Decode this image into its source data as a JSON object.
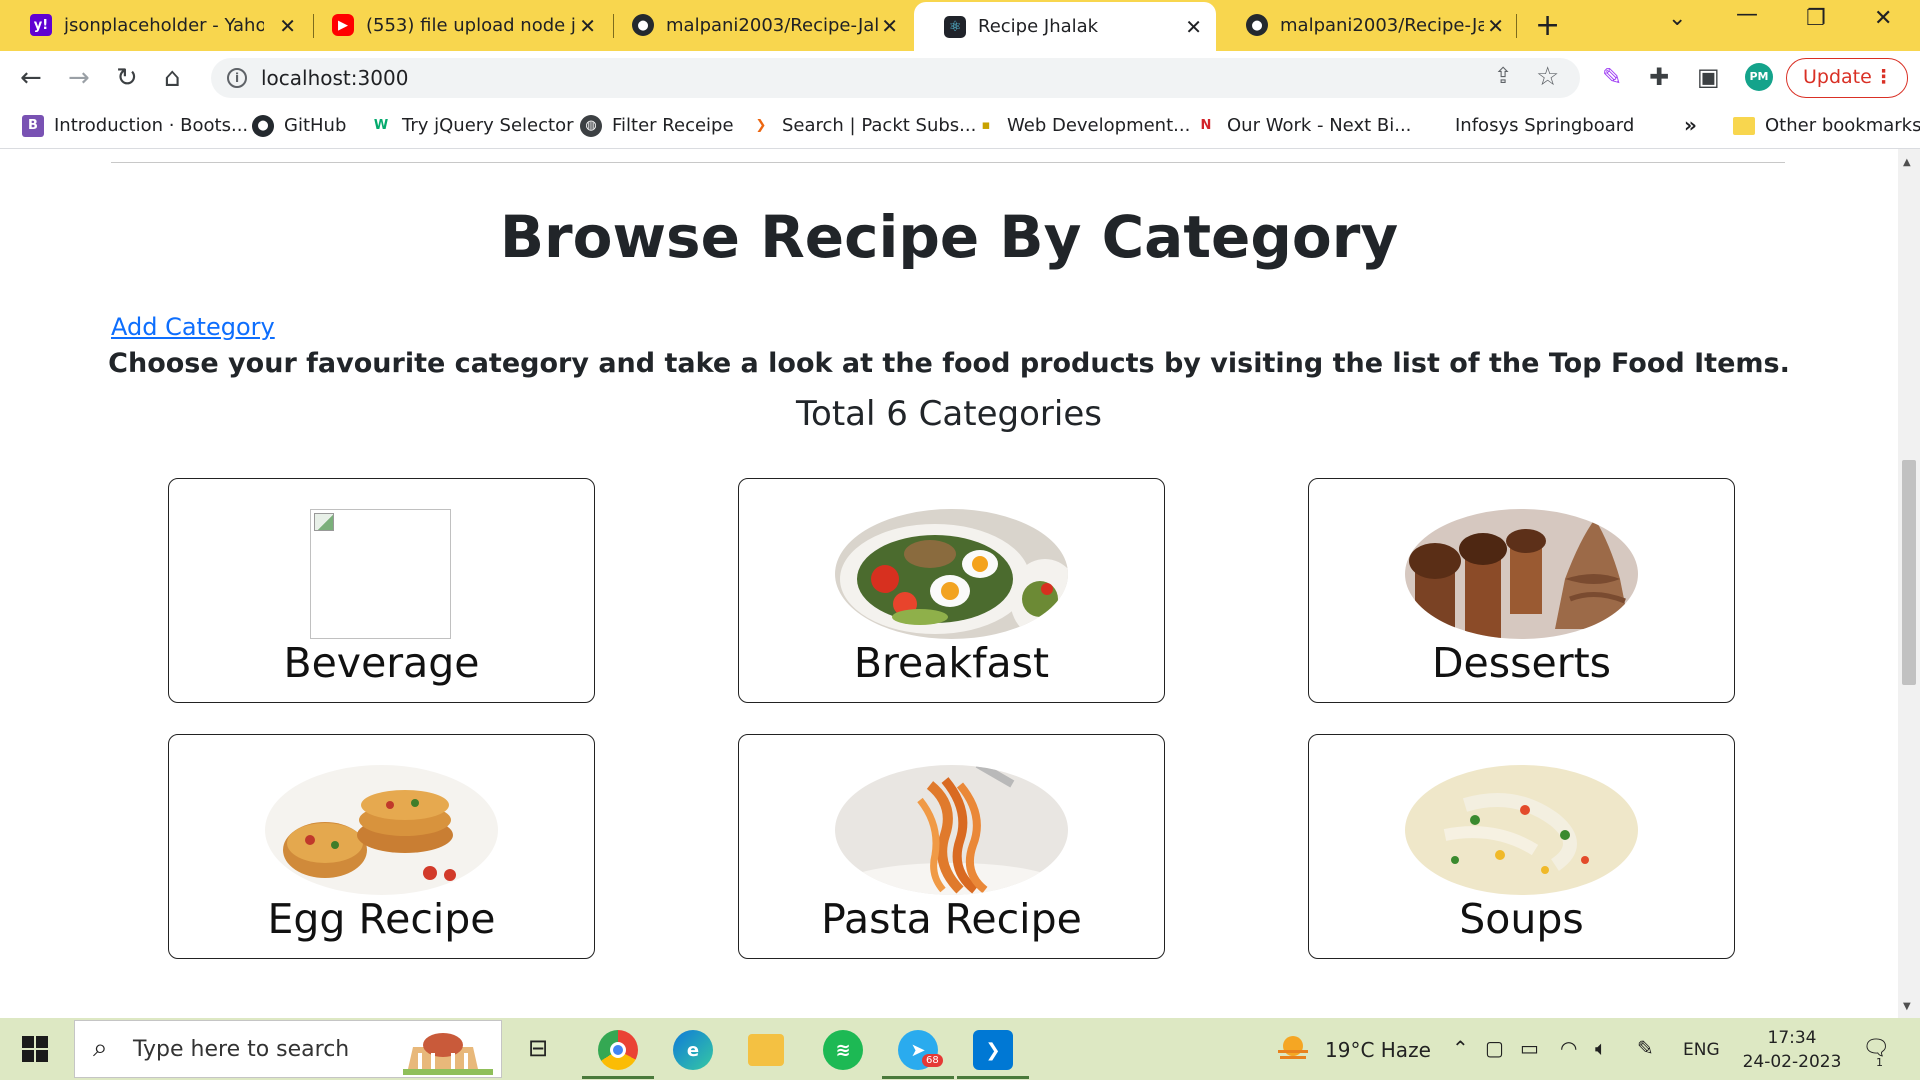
{
  "browser": {
    "tabs": [
      {
        "label": "jsonplaceholder - Yahoo Ir",
        "favicon": "yahoo-icon",
        "active": false
      },
      {
        "label": "(553) file upload node js n",
        "favicon": "youtube-icon",
        "active": false
      },
      {
        "label": "malpani2003/Recipe-Jalak",
        "favicon": "github-icon",
        "active": false
      },
      {
        "label": "Recipe Jhalak",
        "favicon": "react-icon",
        "active": true
      },
      {
        "label": "malpani2003/Recipe-Jalak",
        "favicon": "github-icon",
        "active": false
      }
    ],
    "url": "localhost:3000",
    "update_label": "Update",
    "profile_initials": "PM",
    "bookmarks": [
      {
        "label": "Introduction · Boots...",
        "icon": "bootstrap-icon"
      },
      {
        "label": "GitHub",
        "icon": "github-icon"
      },
      {
        "label": "Try jQuery Selector",
        "icon": "w3schools-icon"
      },
      {
        "label": "Filter Receipe",
        "icon": "globe-icon"
      },
      {
        "label": "Search | Packt Subs...",
        "icon": "packt-icon"
      },
      {
        "label": "Web Development...",
        "icon": "bookmark-icon"
      },
      {
        "label": "Our Work - Next Bi...",
        "icon": "nct-icon"
      },
      {
        "label": "Infosys Springboard",
        "icon": ""
      }
    ],
    "bookmarks_more": "»",
    "other_bookmarks": "Other bookmarks"
  },
  "page": {
    "title": "Browse Recipe By Category",
    "add_category_link": "Add Category",
    "intro": "Choose your favourite category and take a look at the food products by visiting the list of the Top Food Items.",
    "total": "Total 6 Categories",
    "categories": [
      {
        "name": "Beverage",
        "image": "broken"
      },
      {
        "name": "Breakfast",
        "image": "breakfast-bowl"
      },
      {
        "name": "Desserts",
        "image": "chocolate-cupcakes"
      },
      {
        "name": "Egg Recipe",
        "image": "egg-muffins"
      },
      {
        "name": "Pasta Recipe",
        "image": "spaghetti-fork"
      },
      {
        "name": "Soups",
        "image": "creamy-soup"
      }
    ]
  },
  "taskbar": {
    "search_placeholder": "Type here to search",
    "apps": [
      "task-view-icon",
      "chrome-icon",
      "edge-icon",
      "file-explorer-icon",
      "spotify-icon",
      "telegram-icon",
      "vscode-icon"
    ],
    "telegram_badge": "68",
    "weather": "19°C  Haze",
    "language": "ENG",
    "time": "17:34",
    "date": "24-02-2023",
    "notification_count": "1"
  },
  "colors": {
    "tab_strip": "#f8d64e",
    "link": "#0d6efd",
    "update": "#d93025",
    "taskbar": "#dde8c3"
  }
}
